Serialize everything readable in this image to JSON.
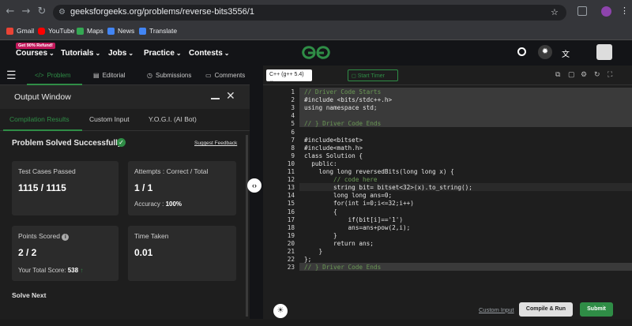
{
  "browser": {
    "url": "geeksforgeeks.org/problems/reverse-bits3556/1",
    "bookmarks": [
      "Gmail",
      "YouTube",
      "Maps",
      "News",
      "Translate"
    ]
  },
  "nav": {
    "promo": "Get 90% Refund!",
    "items": [
      "Courses",
      "Tutorials",
      "Jobs",
      "Practice",
      "Contests"
    ]
  },
  "tabs": [
    "Problem",
    "Editorial",
    "Submissions",
    "Comments"
  ],
  "output": {
    "title": "Output Window",
    "subtabs": [
      "Compilation Results",
      "Custom Input",
      "Y.O.G.I. (AI Bot)"
    ],
    "status": "Problem Solved Successfully",
    "feedback": "Suggest Feedback",
    "test_cases_label": "Test Cases Passed",
    "test_cases_value": "1115 / 1115",
    "attempts_label": "Attempts : Correct / Total",
    "attempts_value": "1 / 1",
    "accuracy_label": "Accuracy :",
    "accuracy_value": "100%",
    "points_label": "Points Scored",
    "points_value": "2 / 2",
    "total_score_label": "Your Total Score:",
    "total_score_value": "538",
    "time_label": "Time Taken",
    "time_value": "0.01",
    "solve_next": "Solve Next"
  },
  "editor": {
    "language": "C++ (g++ 5.4)",
    "timer": "Start Timer",
    "custom_input": "Custom Input",
    "compile_run": "Compile & Run",
    "submit": "Submit",
    "lines": [
      {
        "n": "1",
        "text": "// Driver Code Starts",
        "color": "#6a9955",
        "bg": "#3a3a3a"
      },
      {
        "n": "2",
        "text": "#include <bits/stdc++.h>",
        "color": "#e6e6e6",
        "bg": "#3a3a3a"
      },
      {
        "n": "3",
        "text": "using namespace std;",
        "color": "#e6e6e6",
        "bg": "#3a3a3a"
      },
      {
        "n": "4",
        "text": "",
        "color": "#e6e6e6",
        "bg": "#3a3a3a"
      },
      {
        "n": "5",
        "text": "// } Driver Code Ends",
        "color": "#6a9955",
        "bg": "#3a3a3a"
      },
      {
        "n": "6",
        "text": "",
        "color": "#e6e6e6",
        "bg": ""
      },
      {
        "n": "7",
        "text": "#include<bitset>",
        "color": "#e6e6e6",
        "bg": ""
      },
      {
        "n": "8",
        "text": "#include<math.h>",
        "color": "#e6e6e6",
        "bg": ""
      },
      {
        "n": "9",
        "text": "class Solution {",
        "color": "#e6e6e6",
        "bg": ""
      },
      {
        "n": "10",
        "text": "  public:",
        "color": "#e6e6e6",
        "bg": ""
      },
      {
        "n": "11",
        "text": "    long long reversedBits(long long x) {",
        "color": "#e6e6e6",
        "bg": ""
      },
      {
        "n": "12",
        "text": "        // code here",
        "color": "#6a9955",
        "bg": ""
      },
      {
        "n": "13",
        "text": "        string bit= bitset<32>(x).to_string();",
        "color": "#e6e6e6",
        "bg": "#2a2a2a"
      },
      {
        "n": "14",
        "text": "        long long ans=0;",
        "color": "#e6e6e6",
        "bg": ""
      },
      {
        "n": "15",
        "text": "        for(int i=0;i<=32;i++)",
        "color": "#e6e6e6",
        "bg": ""
      },
      {
        "n": "16",
        "text": "        {",
        "color": "#e6e6e6",
        "bg": ""
      },
      {
        "n": "17",
        "text": "            if(bit[i]=='1')",
        "color": "#e6e6e6",
        "bg": ""
      },
      {
        "n": "18",
        "text": "            ans=ans+pow(2,i);",
        "color": "#e6e6e6",
        "bg": ""
      },
      {
        "n": "19",
        "text": "        }",
        "color": "#e6e6e6",
        "bg": ""
      },
      {
        "n": "20",
        "text": "        return ans;",
        "color": "#e6e6e6",
        "bg": ""
      },
      {
        "n": "21",
        "text": "    }",
        "color": "#e6e6e6",
        "bg": ""
      },
      {
        "n": "22",
        "text": "};",
        "color": "#e6e6e6",
        "bg": ""
      },
      {
        "n": "23",
        "text": "// } Driver Code Ends",
        "color": "#6a9955",
        "bg": "#3a3a3a"
      }
    ]
  },
  "colors": {
    "accent_green": "#2f8d46",
    "success": "#2f8d46"
  }
}
